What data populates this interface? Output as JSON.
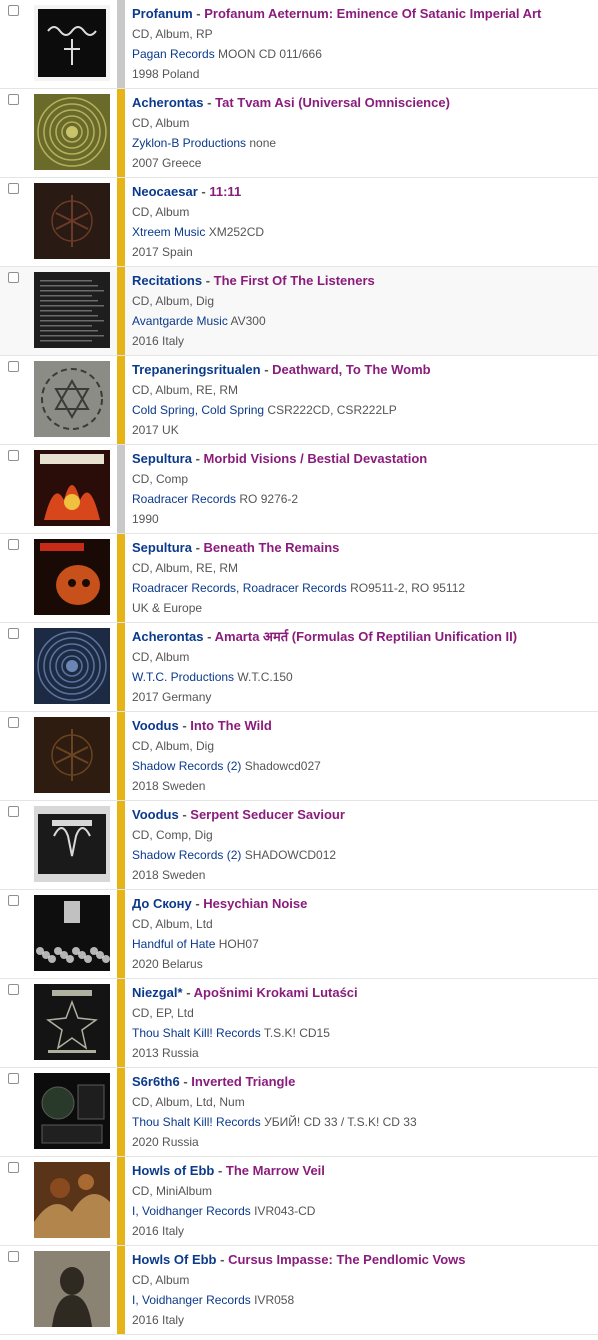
{
  "colors": {
    "artist": "#0b3a8c",
    "title": "#8a1c7c",
    "bar_yellow": "#e7b418",
    "bar_grey": "#c9c9c9",
    "text_grey": "#555555"
  },
  "items": [
    {
      "artist": "Profanum",
      "sep": "-",
      "title": "Profanum Aeternum: Eminence Of Satanic Imperial Art",
      "format": "CD, Album, RP",
      "labels": [
        "Pagan Records"
      ],
      "catno": " MOON CD 011/666",
      "meta": "1998 Poland",
      "bar": "grey",
      "alt": false,
      "thumb": {
        "bg": "#f4f4f4",
        "fg": "#111111",
        "style": "logo-dark"
      }
    },
    {
      "artist": "Acherontas",
      "sep": "-",
      "title": "Tat Tvam Asi (Universal Omniscience)",
      "format": "CD, Album",
      "labels": [
        "Zyklon-B Productions"
      ],
      "catno": " none",
      "meta": "2007 Greece",
      "bar": "yellow",
      "alt": false,
      "thumb": {
        "bg": "#6a6a2a",
        "fg": "#c8c26a",
        "style": "mandala"
      }
    },
    {
      "artist": "Neocaesar",
      "sep": "-",
      "title": "11:11",
      "format": "CD, Album",
      "labels": [
        "Xtreem Music"
      ],
      "catno": " XM252CD",
      "meta": "2017 Spain",
      "bar": "yellow",
      "alt": false,
      "thumb": {
        "bg": "#2a1a14",
        "fg": "#6b3a28",
        "style": "dark-sigil"
      }
    },
    {
      "artist": "Recitations",
      "sep": "-",
      "title": "The First Of The Listeners",
      "format": "CD, Album, Dig",
      "labels": [
        "Avantgarde Music"
      ],
      "catno": " AV300",
      "meta": "2016 Italy",
      "bar": "yellow",
      "alt": true,
      "thumb": {
        "bg": "#1e1e1e",
        "fg": "#8c8c8c",
        "style": "text-lines"
      }
    },
    {
      "artist": "Trepaneringsritualen",
      "sep": "-",
      "title": "Deathward, To The Womb",
      "format": "CD, Album, RE, RM",
      "labels": [
        "Cold Spring",
        "Cold Spring"
      ],
      "catno": " CSR222CD, CSR222LP",
      "meta": "2017 UK",
      "bar": "yellow",
      "alt": false,
      "thumb": {
        "bg": "#8c8c86",
        "fg": "#3a3a36",
        "style": "hexagram"
      }
    },
    {
      "artist": "Sepultura",
      "sep": "-",
      "title": "Morbid Visions / Bestial Devastation",
      "format": "CD, Comp",
      "labels": [
        "Roadracer Records"
      ],
      "catno": " RO 9276-2",
      "meta": "1990",
      "bar": "grey",
      "alt": false,
      "thumb": {
        "bg": "#2a0c08",
        "fg": "#d8461c",
        "style": "fire"
      }
    },
    {
      "artist": "Sepultura",
      "sep": "-",
      "title": "Beneath The Remains",
      "format": "CD, Album, RE, RM",
      "labels": [
        "Roadracer Records",
        "Roadracer Records"
      ],
      "catno": " RO9511-2, RO 95112",
      "meta": "UK & Europe",
      "bar": "yellow",
      "alt": false,
      "thumb": {
        "bg": "#1a0a06",
        "fg": "#c8501a",
        "style": "skull"
      }
    },
    {
      "artist": "Acherontas",
      "sep": "-",
      "title": "Amarta अमर्त (Formulas Of Reptilian Unification II)",
      "format": "CD, Album",
      "labels": [
        "W.T.C. Productions"
      ],
      "catno": " W.T.C.150",
      "meta": "2017 Germany",
      "bar": "yellow",
      "alt": false,
      "thumb": {
        "bg": "#1c2a44",
        "fg": "#6a86b4",
        "style": "mandala"
      }
    },
    {
      "artist": "Voodus",
      "sep": "-",
      "title": "Into The Wild",
      "format": "CD, Album, Dig",
      "labels": [
        "Shadow Records (2)"
      ],
      "catno": " Shadowcd027",
      "meta": "2018 Sweden",
      "bar": "yellow",
      "alt": false,
      "thumb": {
        "bg": "#2e1c10",
        "fg": "#6a4422",
        "style": "dark-sigil"
      }
    },
    {
      "artist": "Voodus",
      "sep": "-",
      "title": "Serpent Seducer Saviour",
      "format": "CD, Comp, Dig",
      "labels": [
        "Shadow Records (2)"
      ],
      "catno": " SHADOWCD012",
      "meta": "2018 Sweden",
      "bar": "yellow",
      "alt": false,
      "thumb": {
        "bg": "#d8d8d8",
        "fg": "#1a1a1a",
        "style": "goat"
      }
    },
    {
      "artist": "До Скону",
      "sep": "-",
      "title": "Hesychian Noise",
      "format": "CD, Album, Ltd",
      "labels": [
        "Handful of Hate"
      ],
      "catno": " HOH07",
      "meta": "2020 Belarus",
      "bar": "yellow",
      "alt": false,
      "thumb": {
        "bg": "#0e0e0e",
        "fg": "#e0e0e0",
        "style": "crowd"
      }
    },
    {
      "artist": "Niezgal*",
      "sep": "-",
      "title": "Apošnimi Krokami Lutaści",
      "format": "CD, EP, Ltd",
      "labels": [
        "Thou Shalt Kill! Records"
      ],
      "catno": " T.S.K! CD15",
      "meta": "2013 Russia",
      "bar": "yellow",
      "alt": false,
      "thumb": {
        "bg": "#141414",
        "fg": "#b0b0a0",
        "style": "star"
      }
    },
    {
      "artist": "S6r6th6",
      "sep": "-",
      "title": "Inverted Triangle",
      "format": "CD, Album, Ltd, Num",
      "labels": [
        "Thou Shalt Kill! Records"
      ],
      "catno": " УБИЙ! CD 33 / T.S.K! CD 33",
      "meta": "2020 Russia",
      "bar": "yellow",
      "alt": false,
      "thumb": {
        "bg": "#0c0c0c",
        "fg": "#5a5a5a",
        "style": "package"
      }
    },
    {
      "artist": "Howls of Ebb",
      "sep": "-",
      "title": "The Marrow Veil",
      "format": "CD, MiniAlbum",
      "labels": [
        "I",
        "Voidhanger Records"
      ],
      "catno": " IVR043-CD",
      "meta": "2016 Italy",
      "bar": "yellow",
      "alt": false,
      "thumb": {
        "bg": "#5a3418",
        "fg": "#c89a5a",
        "style": "painting"
      }
    },
    {
      "artist": "Howls Of Ebb",
      "sep": "-",
      "title": "Cursus Impasse: The Pendlomic Vows",
      "format": "CD, Album",
      "labels": [
        "I",
        "Voidhanger Records"
      ],
      "catno": " IVR058",
      "meta": "2016 Italy",
      "bar": "yellow",
      "alt": false,
      "thumb": {
        "bg": "#8a8272",
        "fg": "#2e2a22",
        "style": "figure"
      }
    }
  ]
}
